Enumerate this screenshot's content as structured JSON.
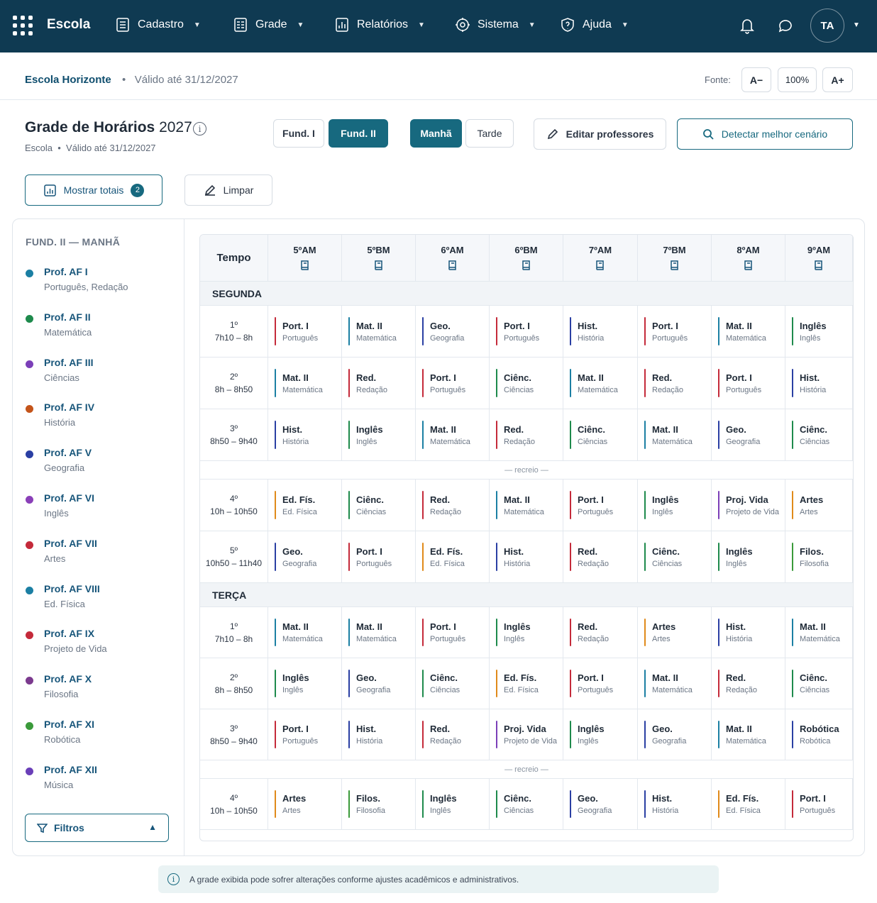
{
  "app": {
    "title": "Escola"
  },
  "nav": [
    {
      "label": "Cadastro",
      "icon": "list-icon"
    },
    {
      "label": "Grade",
      "icon": "grid-icon"
    },
    {
      "label": "Relatórios",
      "icon": "report-icon"
    },
    {
      "label": "Sistema",
      "icon": "gear-icon"
    },
    {
      "label": "Ajuda",
      "icon": "help-icon"
    }
  ],
  "user": {
    "initials": "TA"
  },
  "subheader": {
    "school": "Escola Horizonte",
    "valid": "Válido até 31/12/2027",
    "font_label": "Fonte:",
    "font_decrease": "A−",
    "font_zoom": "100%",
    "font_increase": "A+"
  },
  "page": {
    "title": "Grade de Horários",
    "year": "2027",
    "school": "Escola",
    "valid": "Válido até 31/12/2027"
  },
  "levels": [
    "Fund. I",
    "Fund. II"
  ],
  "levels_selected": "Fund. II",
  "shifts": [
    "Manhã",
    "Tarde"
  ],
  "shifts_selected": "Manhã",
  "actions": {
    "edit_teachers": "Editar professores",
    "detect_scenario": "Detectar melhor cenário",
    "show_totals": "Mostrar totais",
    "totals_count": "2",
    "clear": "Limpar"
  },
  "sidebar": {
    "heading": "FUND. II — MANHÃ",
    "teachers": [
      {
        "name": "Prof. AF I",
        "subjects": "Português, Redação",
        "color": "#1b7fa3"
      },
      {
        "name": "Prof. AF II",
        "subjects": "Matemática",
        "color": "#1e8a4c"
      },
      {
        "name": "Prof. AF III",
        "subjects": "Ciências",
        "color": "#7b3fb8"
      },
      {
        "name": "Prof. AF IV",
        "subjects": "História",
        "color": "#c4541a"
      },
      {
        "name": "Prof. AF V",
        "subjects": "Geografia",
        "color": "#2a3fa3"
      },
      {
        "name": "Prof. AF VI",
        "subjects": "Inglês",
        "color": "#8a3fb8"
      },
      {
        "name": "Prof. AF VII",
        "subjects": "Artes",
        "color": "#c42a3a"
      },
      {
        "name": "Prof. AF VIII",
        "subjects": "Ed. Física",
        "color": "#1b7fa3"
      },
      {
        "name": "Prof. AF IX",
        "subjects": "Projeto de Vida",
        "color": "#c42a3a"
      },
      {
        "name": "Prof. AF X",
        "subjects": "Filosofia",
        "color": "#7b3a8e"
      },
      {
        "name": "Prof. AF XI",
        "subjects": "Robótica",
        "color": "#3a9a3a"
      },
      {
        "name": "Prof. AF XII",
        "subjects": "Música",
        "color": "#6a3fb8"
      }
    ],
    "filters_label": "Filtros"
  },
  "schedule": {
    "time_header": "Tempo",
    "classes": [
      "5ºAM",
      "5ºBM",
      "6ºAM",
      "6ºBM",
      "7ºAM",
      "7ºBM",
      "8ºAM",
      "9ºAM"
    ],
    "break_label": "— recreio —",
    "days": [
      {
        "name": "SEGUNDA",
        "rows": [
          {
            "slot": "1º",
            "time": "7h10 – 8h",
            "cells": [
              [
                "Port. I",
                "Português"
              ],
              [
                "Mat. II",
                "Matemática"
              ],
              [
                "Geo.",
                "Geografia"
              ],
              [
                "Port. I",
                "Português"
              ],
              [
                "Hist.",
                "História"
              ],
              [
                "Port. I",
                "Português"
              ],
              [
                "Mat. II",
                "Matemática"
              ],
              [
                "Inglês",
                "Inglês"
              ]
            ]
          },
          {
            "slot": "2º",
            "time": "8h – 8h50",
            "cells": [
              [
                "Mat. II",
                "Matemática"
              ],
              [
                "Red.",
                "Redação"
              ],
              [
                "Port. I",
                "Português"
              ],
              [
                "Ciênc.",
                "Ciências"
              ],
              [
                "Mat. II",
                "Matemática"
              ],
              [
                "Red.",
                "Redação"
              ],
              [
                "Port. I",
                "Português"
              ],
              [
                "Hist.",
                "História"
              ]
            ]
          },
          {
            "slot": "3º",
            "time": "8h50 – 9h40",
            "cells": [
              [
                "Hist.",
                "História"
              ],
              [
                "Inglês",
                "Inglês"
              ],
              [
                "Mat. II",
                "Matemática"
              ],
              [
                "Red.",
                "Redação"
              ],
              [
                "Ciênc.",
                "Ciências"
              ],
              [
                "Mat. II",
                "Matemática"
              ],
              [
                "Geo.",
                "Geografia"
              ],
              [
                "Ciênc.",
                "Ciências"
              ]
            ]
          },
          {
            "break": true
          },
          {
            "slot": "4º",
            "time": "10h – 10h50",
            "cells": [
              [
                "Ed. Fís.",
                "Ed. Física"
              ],
              [
                "Ciênc.",
                "Ciências"
              ],
              [
                "Red.",
                "Redação"
              ],
              [
                "Mat. II",
                "Matemática"
              ],
              [
                "Port. I",
                "Português"
              ],
              [
                "Inglês",
                "Inglês"
              ],
              [
                "Proj. Vida",
                "Projeto de Vida"
              ],
              [
                "Artes",
                "Artes"
              ]
            ]
          },
          {
            "slot": "5º",
            "time": "10h50 – 11h40",
            "cells": [
              [
                "Geo.",
                "Geografia"
              ],
              [
                "Port. I",
                "Português"
              ],
              [
                "Ed. Fís.",
                "Ed. Física"
              ],
              [
                "Hist.",
                "História"
              ],
              [
                "Red.",
                "Redação"
              ],
              [
                "Ciênc.",
                "Ciências"
              ],
              [
                "Inglês",
                "Inglês"
              ],
              [
                "Filos.",
                "Filosofia"
              ]
            ]
          }
        ]
      },
      {
        "name": "TERÇA",
        "rows": [
          {
            "slot": "1º",
            "time": "7h10 – 8h",
            "cells": [
              [
                "Mat. II",
                "Matemática"
              ],
              [
                "Mat. II",
                "Matemática"
              ],
              [
                "Port. I",
                "Português"
              ],
              [
                "Inglês",
                "Inglês"
              ],
              [
                "Red.",
                "Redação"
              ],
              [
                "Artes",
                "Artes"
              ],
              [
                "Hist.",
                "História"
              ],
              [
                "Mat. II",
                "Matemática"
              ]
            ]
          },
          {
            "slot": "2º",
            "time": "8h – 8h50",
            "cells": [
              [
                "Inglês",
                "Inglês"
              ],
              [
                "Geo.",
                "Geografia"
              ],
              [
                "Ciênc.",
                "Ciências"
              ],
              [
                "Ed. Fís.",
                "Ed. Física"
              ],
              [
                "Port. I",
                "Português"
              ],
              [
                "Mat. II",
                "Matemática"
              ],
              [
                "Red.",
                "Redação"
              ],
              [
                "Ciênc.",
                "Ciências"
              ]
            ]
          },
          {
            "slot": "3º",
            "time": "8h50 – 9h40",
            "cells": [
              [
                "Port. I",
                "Português"
              ],
              [
                "Hist.",
                "História"
              ],
              [
                "Red.",
                "Redação"
              ],
              [
                "Proj. Vida",
                "Projeto de Vida"
              ],
              [
                "Inglês",
                "Inglês"
              ],
              [
                "Geo.",
                "Geografia"
              ],
              [
                "Mat. II",
                "Matemática"
              ],
              [
                "Robótica",
                "Robótica"
              ]
            ]
          },
          {
            "break": true
          },
          {
            "slot": "4º",
            "time": "10h – 10h50",
            "cells": [
              [
                "Artes",
                "Artes"
              ],
              [
                "Filos.",
                "Filosofia"
              ],
              [
                "Inglês",
                "Inglês"
              ],
              [
                "Ciênc.",
                "Ciências"
              ],
              [
                "Geo.",
                "Geografia"
              ],
              [
                "Hist.",
                "História"
              ],
              [
                "Ed. Fís.",
                "Ed. Física"
              ],
              [
                "Port. I",
                "Português"
              ]
            ]
          }
        ]
      }
    ]
  },
  "subject_colors": {
    "Port. I": "#c42a3a",
    "Red.": "#c42a3a",
    "Mat. II": "#1b7fa3",
    "Geo.": "#2a3fa3",
    "Hist.": "#2a3fa3",
    "Ciênc.": "#1e8a4c",
    "Inglês": "#1e8a4c",
    "Ed. Fís.": "#e08a1a",
    "Artes": "#e08a1a",
    "Proj. Vida": "#7b3fb8",
    "Filos.": "#3a9a3a",
    "Robótica": "#2a3fa3"
  },
  "footnote": "A grade exibida pode sofrer alterações conforme ajustes acadêmicos e administrativos."
}
